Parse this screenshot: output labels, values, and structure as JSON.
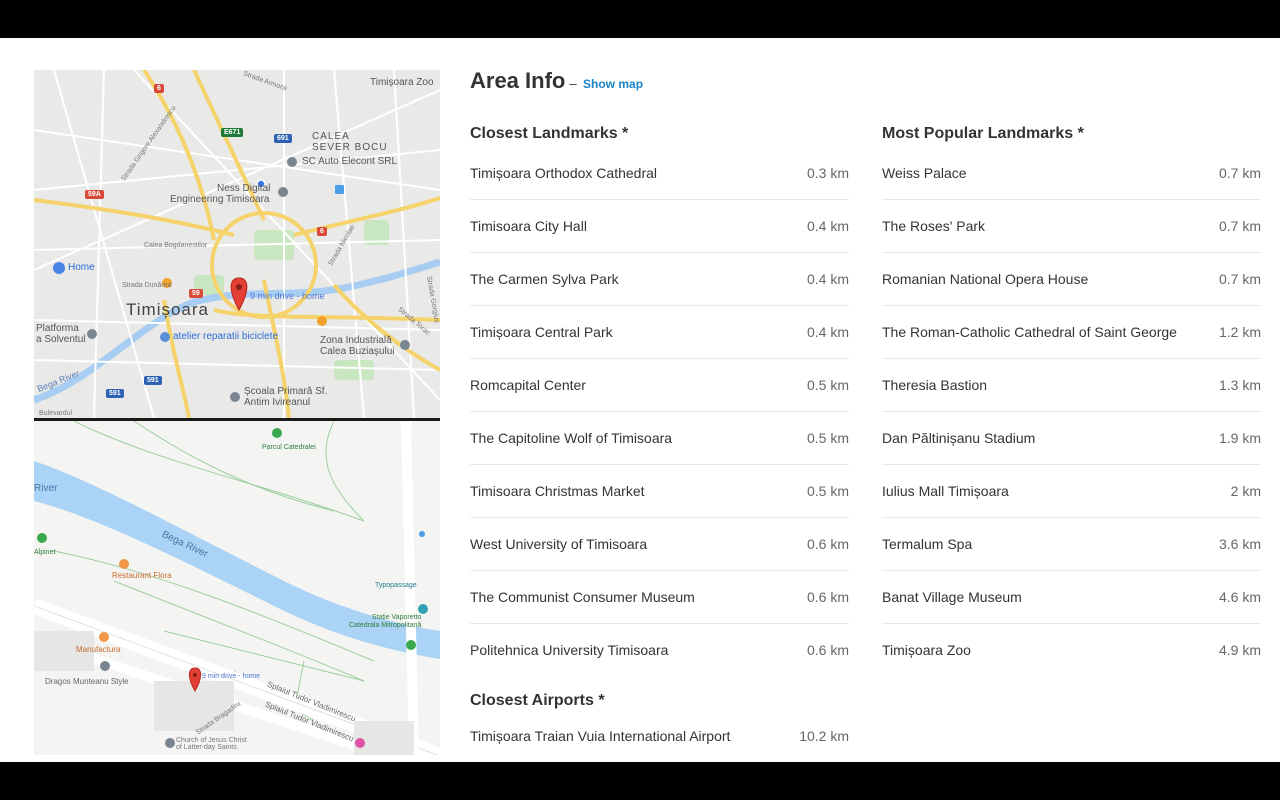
{
  "area_info": {
    "title": "Area Info",
    "separator": "–",
    "show_map_label": "Show map"
  },
  "closest_landmarks": {
    "title": "Closest Landmarks *",
    "items": [
      {
        "name": "Timișoara Orthodox Cathedral",
        "distance": "0.3 km"
      },
      {
        "name": "Timisoara City Hall",
        "distance": "0.4 km"
      },
      {
        "name": "The Carmen Sylva Park",
        "distance": "0.4 km"
      },
      {
        "name": "Timișoara Central Park",
        "distance": "0.4 km"
      },
      {
        "name": "Romcapital Center",
        "distance": "0.5 km"
      },
      {
        "name": "The Capitoline Wolf of Timisoara",
        "distance": "0.5 km"
      },
      {
        "name": "Timisoara Christmas Market",
        "distance": "0.5 km"
      },
      {
        "name": "West University of Timisoara",
        "distance": "0.6 km"
      },
      {
        "name": "The Communist Consumer Museum",
        "distance": "0.6 km"
      },
      {
        "name": "Politehnica University Timisoara",
        "distance": "0.6 km"
      }
    ]
  },
  "popular_landmarks": {
    "title": "Most Popular Landmarks *",
    "items": [
      {
        "name": "Weiss Palace",
        "distance": "0.7 km"
      },
      {
        "name": "The Roses' Park",
        "distance": "0.7 km"
      },
      {
        "name": "Romanian National Opera House",
        "distance": "0.7 km"
      },
      {
        "name": "The Roman-Catholic Cathedral of Saint George",
        "distance": "1.2 km"
      },
      {
        "name": "Theresia Bastion",
        "distance": "1.3 km"
      },
      {
        "name": "Dan Păltinișanu Stadium",
        "distance": "1.9 km"
      },
      {
        "name": "Iulius Mall Timișoara",
        "distance": "2 km"
      },
      {
        "name": "Termalum Spa",
        "distance": "3.6 km"
      },
      {
        "name": "Banat Village Museum",
        "distance": "4.6 km"
      },
      {
        "name": "Timișoara Zoo",
        "distance": "4.9 km"
      }
    ]
  },
  "closest_airports": {
    "title": "Closest Airports *",
    "items": [
      {
        "name": "Timișoara Traian Vuia International Airport",
        "distance": "10.2 km"
      }
    ]
  },
  "map_top": {
    "city": "Timișoara",
    "zoo": "Timișoara Zoo",
    "neighborhood_line1": "CALEA",
    "neighborhood_line2": "SEVER BOCU",
    "auto_elecont": "SC Auto Elecont SRL",
    "ness_line1": "Ness Digital",
    "ness_line2": "Engineering Timisoara",
    "home": "Home",
    "drive": "9 min drive - home",
    "platforma_line1": "Platforma",
    "platforma_line2": "a Solventul",
    "atelier": "atelier reparatii biciclete",
    "zona_line1": "Zona Industrială",
    "zona_line2": "Calea Buziașului",
    "scoala_line1": "Școala Primară Sf.",
    "scoala_line2": "Antim Ivireanul",
    "bega": "Bega River",
    "road_armonii": "Strada Armonii",
    "road_alexandrescu": "Strada Grigore Alexandrescu",
    "road_bogdanestilor": "Calea Bogdanestilor",
    "road_dunarea": "Strada Dunărea",
    "road_nicolae": "Strada Nicolae",
    "road_gorgius": "Strada Gorgius",
    "road_torac": "Strada Torac",
    "road_bulevard": "Bulevardul",
    "shield_6a": "6",
    "shield_e671": "E671",
    "shield_691": "691",
    "shield_59a": "59A",
    "shield_6b": "6",
    "shield_59": "59",
    "shield_591a": "591",
    "shield_591b": "591"
  },
  "map_bottom": {
    "parc": "Parcul Catedralei",
    "river": "Bega River",
    "river_left": "River",
    "alpinet": "Alpinet",
    "restaurant": "Restaurant Flora",
    "typopassage": "Typopassage",
    "statie_line1": "Stație Vaporetto",
    "statie_line2": "Catedrala Mitropolitană",
    "manufactura": "Manufactura",
    "dragos": "Dragos Munteanu Style",
    "drive": "9 min drive - home",
    "splaiul1": "Splaiul Tudor Vladimirescu",
    "splaiul2": "Splaiul Tudor Vladimirescu",
    "strada_bragadiru": "Strada Bragadiru",
    "church_line1": "Church of Jesus Christ",
    "church_line2": "of Latter-day Saints"
  }
}
